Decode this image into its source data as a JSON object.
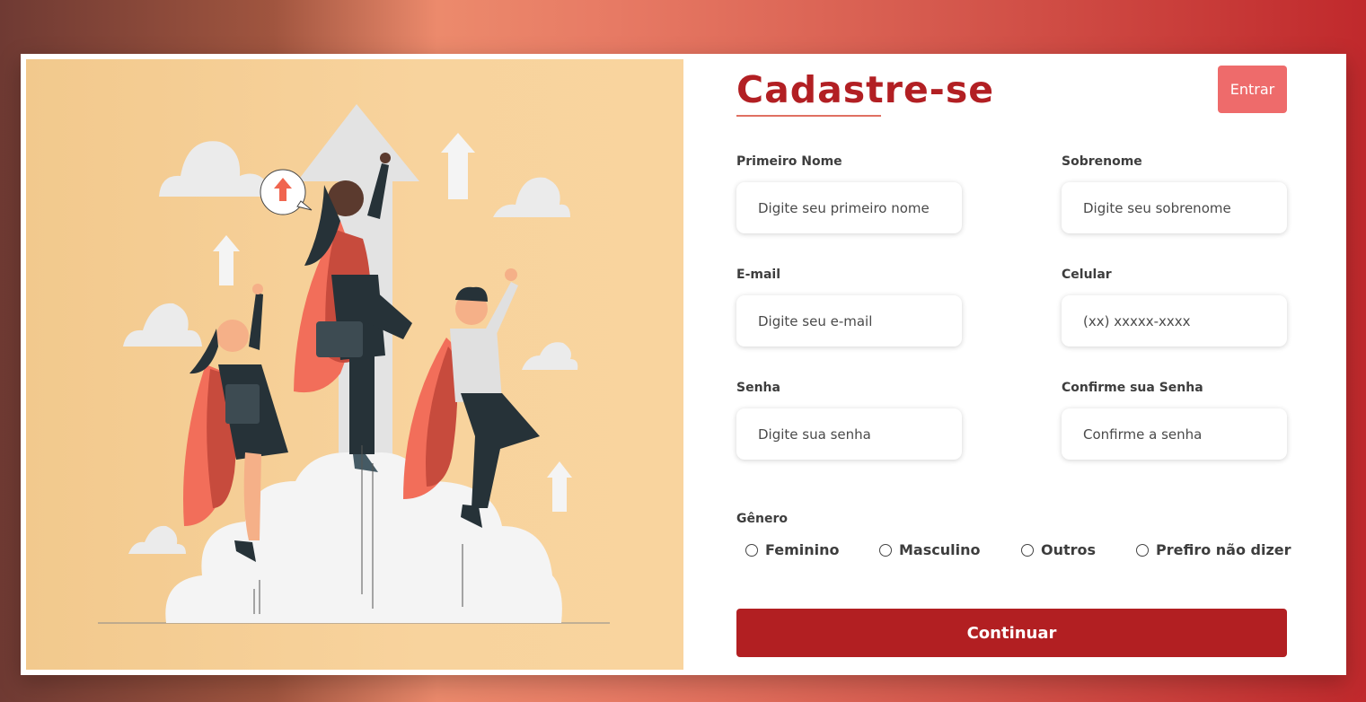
{
  "form": {
    "title": "Cadastre-se",
    "login_label": "Entrar",
    "fields": {
      "first_name": {
        "label": "Primeiro Nome",
        "placeholder": "Digite seu primeiro nome"
      },
      "last_name": {
        "label": "Sobrenome",
        "placeholder": "Digite seu sobrenome"
      },
      "email": {
        "label": "E-mail",
        "placeholder": "Digite seu e-mail"
      },
      "phone": {
        "label": "Celular",
        "placeholder": "(xx) xxxxx-xxxx"
      },
      "password": {
        "label": "Senha",
        "placeholder": "Digite sua senha"
      },
      "confirm_password": {
        "label": "Confirme sua Senha",
        "placeholder": "Confirme a senha"
      }
    },
    "gender": {
      "label": "Gênero",
      "options": [
        "Feminino",
        "Masculino",
        "Outros",
        "Prefiro não dizer"
      ]
    },
    "continue_label": "Continuar"
  },
  "colors": {
    "brand": "#b21f22",
    "accent": "#ee6b6b",
    "illustration_bg": "#f8d39d"
  }
}
